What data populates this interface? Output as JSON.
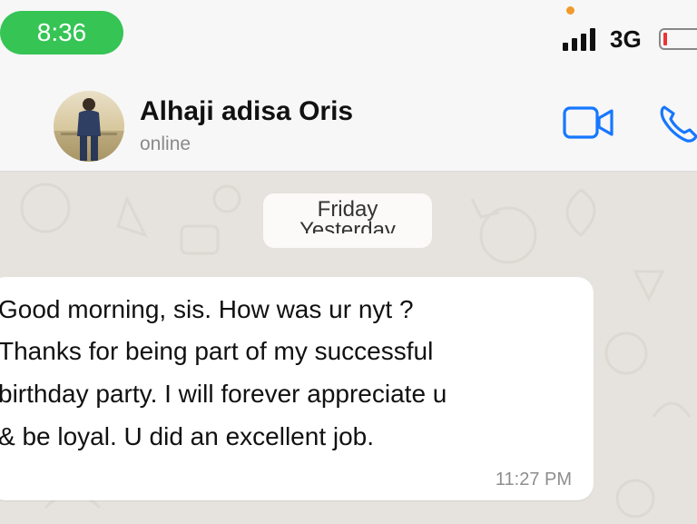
{
  "status_bar": {
    "time": "8:36",
    "network": "3G",
    "colors": {
      "time_pill": "#36c455",
      "dot": "#f09a2c",
      "battery_low": "#e33333"
    }
  },
  "chat_header": {
    "contact_name": "Alhaji adisa Oris",
    "contact_status": "online",
    "icons": [
      "avatar",
      "video-call-icon",
      "voice-call-icon"
    ],
    "accent_color": "#1677ff"
  },
  "chat": {
    "date_chip": {
      "primary": "Friday",
      "secondary": "Yesterday"
    },
    "messages": [
      {
        "lines": [
          "Good morning, sis. How was ur nyt ?",
          "Thanks for being part of my successful",
          "birthday party. I will forever appreciate u",
          "& be loyal. U did an excellent job."
        ],
        "time": "11:27 PM",
        "direction": "incoming"
      }
    ]
  }
}
